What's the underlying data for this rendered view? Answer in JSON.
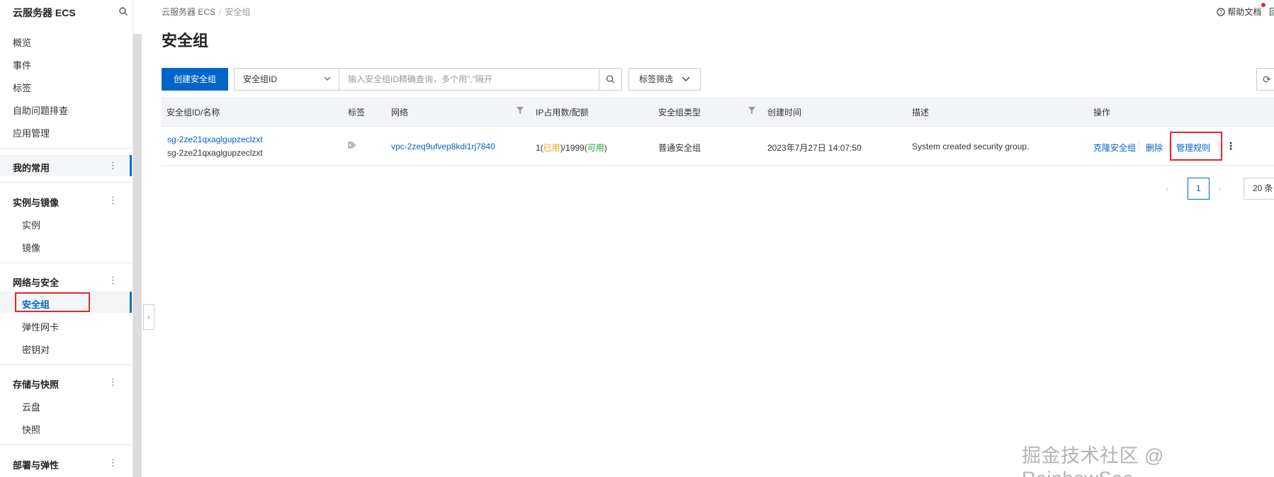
{
  "sidebar": {
    "title": "云服务器 ECS",
    "items": [
      "概览",
      "事件",
      "标签",
      "自助问题排查",
      "应用管理"
    ],
    "favorites": "我的常用",
    "groups": [
      {
        "label": "实例与镜像",
        "items": [
          "实例",
          "镜像"
        ]
      },
      {
        "label": "网络与安全",
        "items": [
          "安全组",
          "弹性网卡",
          "密钥对"
        ]
      },
      {
        "label": "存储与快照",
        "items": [
          "云盘",
          "快照"
        ]
      },
      {
        "label": "部署与弹性",
        "items": []
      }
    ],
    "active_item": "安全组",
    "kebab": "⋮",
    "collapse": "‹"
  },
  "breadcrumb": {
    "root": "云服务器 ECS",
    "sep": "/",
    "current": "安全组"
  },
  "help": {
    "label": "帮助文档",
    "glyph": "回"
  },
  "page_title": "安全组",
  "toolbar": {
    "create_label": "创建安全组",
    "filter_field": "安全组ID",
    "search_placeholder": "输入安全组ID精确查询，多个用\",\"隔开",
    "tag_filter": "标签筛选",
    "refresh": "⟳"
  },
  "table": {
    "columns": [
      "安全组ID/名称",
      "标签",
      "网络",
      "IP占用数/配额",
      "安全组类型",
      "创建时间",
      "描述",
      "操作"
    ],
    "rows": [
      {
        "id": "sg-2ze21qxaglgupzeclzxt",
        "name": "sg-2ze21qxaglgupzeclzxt",
        "vpc": "vpc-2zeq9ufvep8kdi1rj7840",
        "ip_used_prefix": "1(",
        "ip_used_tag": "已用",
        "ip_mid": ")/1999(",
        "ip_avail_tag": "可用",
        "ip_suffix": ")",
        "type": "普通安全组",
        "created": "2023年7月27日 14:07:50",
        "description": "System created security group.",
        "actions": {
          "clone": "克隆安全组",
          "delete": "删除",
          "manage": "管理规则",
          "more": "⋮"
        }
      }
    ]
  },
  "pagination": {
    "prev": "‹",
    "page": "1",
    "next": "›",
    "size": "20 条"
  },
  "watermark": "掘金技术社区 @ RainbowSea",
  "colors": {
    "accent": "#0064c8",
    "highlight": "#e0282e",
    "used": "#e6a100",
    "available": "#1a9a3a"
  }
}
